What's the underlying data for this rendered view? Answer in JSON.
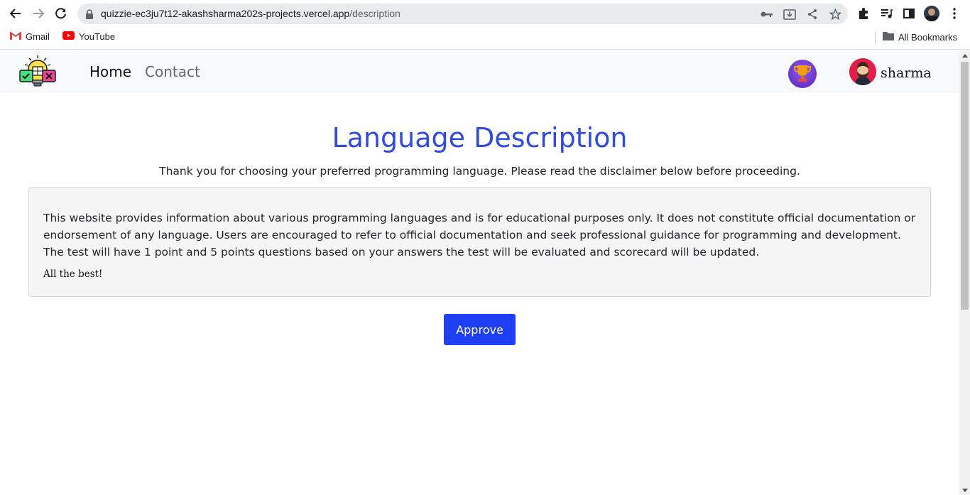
{
  "browser": {
    "url_host": "quizzie-ec3ju7t12-akashsharma202s-projects.vercel.app",
    "url_path": "/description",
    "bookmarks": [
      {
        "label": "Gmail",
        "icon": "gmail-icon"
      },
      {
        "label": "YouTube",
        "icon": "youtube-icon"
      }
    ],
    "all_bookmarks_label": "All Bookmarks"
  },
  "nav": {
    "home_label": "Home",
    "contact_label": "Contact",
    "user_name": "sharma"
  },
  "main": {
    "title": "Language Description",
    "subtitle": "Thank you for choosing your preferred programming language. Please read the disclaimer below before proceeding.",
    "disclaimer": "This website provides information about various programming languages and is for educational purposes only. It does not constitute official documentation or endorsement of any language. Users are encouraged to refer to official documentation and seek professional guidance for programming and development. The test will have 1 point and 5 points questions based on your answers the test will be evaluated and scorecard will be updated.",
    "closing": "All the best!",
    "approve_label": "Approve"
  },
  "colors": {
    "accent": "#2f4be0",
    "button": "#1f3ff5",
    "navbar_bg": "#f8f9fa"
  }
}
